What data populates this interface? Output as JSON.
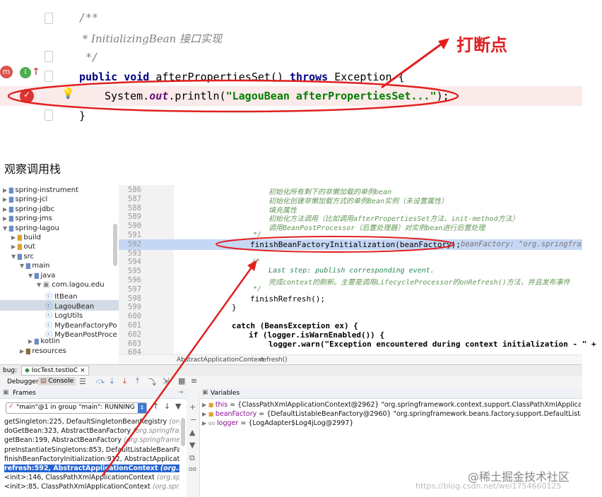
{
  "top_editor": {
    "comment_open": "/**",
    "comment_body": " * InitializingBean 接口实现",
    "comment_close": " */",
    "method_kw1": "public",
    "method_kw2": "void",
    "method_name": "afterPropertiesSet()",
    "method_throws": "throws",
    "method_exception": "Exception {",
    "stmt_prefix": "System.",
    "stmt_field": "out",
    "stmt_call": ".println(",
    "stmt_string": "\"LagouBean afterPropertiesSet...\"",
    "stmt_suffix": ");",
    "closing_brace": "}",
    "annotation": "打断点"
  },
  "section_heading": "观察调用栈",
  "project_tree": [
    {
      "label": "spring-instrument",
      "type": "module",
      "expanded": false
    },
    {
      "label": "spring-jcl",
      "type": "module",
      "expanded": false
    },
    {
      "label": "spring-jdbc",
      "type": "module",
      "expanded": false
    },
    {
      "label": "spring-jms",
      "type": "module",
      "expanded": false
    },
    {
      "label": "spring-lagou",
      "type": "module",
      "expanded": true
    },
    {
      "label": "build",
      "type": "folder",
      "expanded": false
    },
    {
      "label": "out",
      "type": "folder",
      "expanded": false
    },
    {
      "label": "src",
      "type": "folder",
      "expanded": true
    },
    {
      "label": "main",
      "type": "folder",
      "expanded": true
    },
    {
      "label": "java",
      "type": "folder",
      "expanded": true
    },
    {
      "label": "com.lagou.edu",
      "type": "package",
      "expanded": true
    },
    {
      "label": "ItBean",
      "type": "class"
    },
    {
      "label": "LagouBean",
      "type": "class",
      "selected": true
    },
    {
      "label": "LogUtils",
      "type": "class"
    },
    {
      "label": "MyBeanFactoryPo",
      "type": "class"
    },
    {
      "label": "MyBeanPostProce",
      "type": "class"
    },
    {
      "label": "kotlin",
      "type": "folder",
      "expanded": false
    },
    {
      "label": "resources",
      "type": "folder",
      "expanded": false
    }
  ],
  "source_lines": [
    {
      "num": "586",
      "text": "初始化所有剩下的非懒加载的单例bean"
    },
    {
      "num": "587",
      "text": "初始化创建非懒加载方式的单例Bean实例（未设置属性）"
    },
    {
      "num": "588",
      "text": "填充属性"
    },
    {
      "num": "589",
      "text": "初始化方法调用（比如调用afterPropertiesSet方法、init-method方法）"
    },
    {
      "num": "590",
      "text": "调用BeanPostProcessor（后置处理器）对实例bean进行后置处理"
    },
    {
      "num": "591",
      "text": "*/"
    },
    {
      "num": "592",
      "text": "finishBeanFactoryInitialization(beanFactory);",
      "inline_value": "beanFactory: \"org.springfra"
    },
    {
      "num": "593",
      "text": ""
    },
    {
      "num": "594",
      "text": "/*"
    },
    {
      "num": "595",
      "text": "Last step: publish corresponding event."
    },
    {
      "num": "596",
      "text": "完成context的刷新。主要是调用LifecycleProcessor的onRefresh()方法，并且发布事件"
    },
    {
      "num": "597",
      "text": "*/"
    },
    {
      "num": "598",
      "text": "finishRefresh();"
    },
    {
      "num": "599",
      "text": "}"
    },
    {
      "num": "600",
      "text": ""
    },
    {
      "num": "601",
      "text": "catch (BeansException ex) {"
    },
    {
      "num": "602",
      "text": "if (logger.isWarnEnabled()) {"
    },
    {
      "num": "603",
      "text": "logger.warn(\"Exception encountered during context initialization - \" +"
    },
    {
      "num": "604",
      "text": ""
    }
  ],
  "breadcrumb": [
    "AbstractApplicationContext",
    "refresh()"
  ],
  "debug_bar": {
    "label": "bug:",
    "run_config": "IocTest.testIoC",
    "tabs": [
      "Debugger",
      "Console"
    ]
  },
  "frames_panel": {
    "title": "Frames",
    "thread_selector": "\"main\"@1 in group \"main\": RUNNING",
    "frames": [
      {
        "method": "getSingleton:225, DefaultSingletonBeanRegistry",
        "pkg": "(org.spri"
      },
      {
        "method": "doGetBean:323, AbstractBeanFactory",
        "pkg": "(org.springframework"
      },
      {
        "method": "getBean:199, AbstractBeanFactory",
        "pkg": "(org.springframework"
      },
      {
        "method": "preInstantiateSingletons:853, DefaultListableBeanFactory",
        "pkg": ""
      },
      {
        "method": "finishBeanFactoryInitialization:912, AbstractApplicationC",
        "pkg": ""
      },
      {
        "method": "refresh:592, AbstractApplicationContext",
        "pkg": "(org.springfram",
        "selected": true
      },
      {
        "method": "<init>:146, ClassPathXmlApplicationContext",
        "pkg": "(org.spring"
      },
      {
        "method": "<init>:85, ClassPathXmlApplicationContext",
        "pkg": "(org.spring"
      }
    ]
  },
  "variables_panel": {
    "title": "Variables",
    "vars": [
      {
        "name": "this",
        "value": "= {ClassPathXmlApplicationContext@2962} \"org.springframework.context.support.ClassPathXmlApplicationContext@5b"
      },
      {
        "name": "beanFactory",
        "value": "= {DefaultListableBeanFactory@2960} \"org.springframework.beans.factory.support.DefaultListableBeanFactory@"
      },
      {
        "name": "logger",
        "value": "= {LogAdapter$Log4jLog@2997}"
      }
    ]
  },
  "watermark": {
    "text": "@稀土掘金技术社区",
    "url": "https://blog.csdn.net/wei1754660125"
  },
  "colors": {
    "red_annotation": "#e02020",
    "highlight_line": "#fbeaea",
    "exec_line": "#c6d7f5",
    "selected_frame": "#2463d1"
  }
}
